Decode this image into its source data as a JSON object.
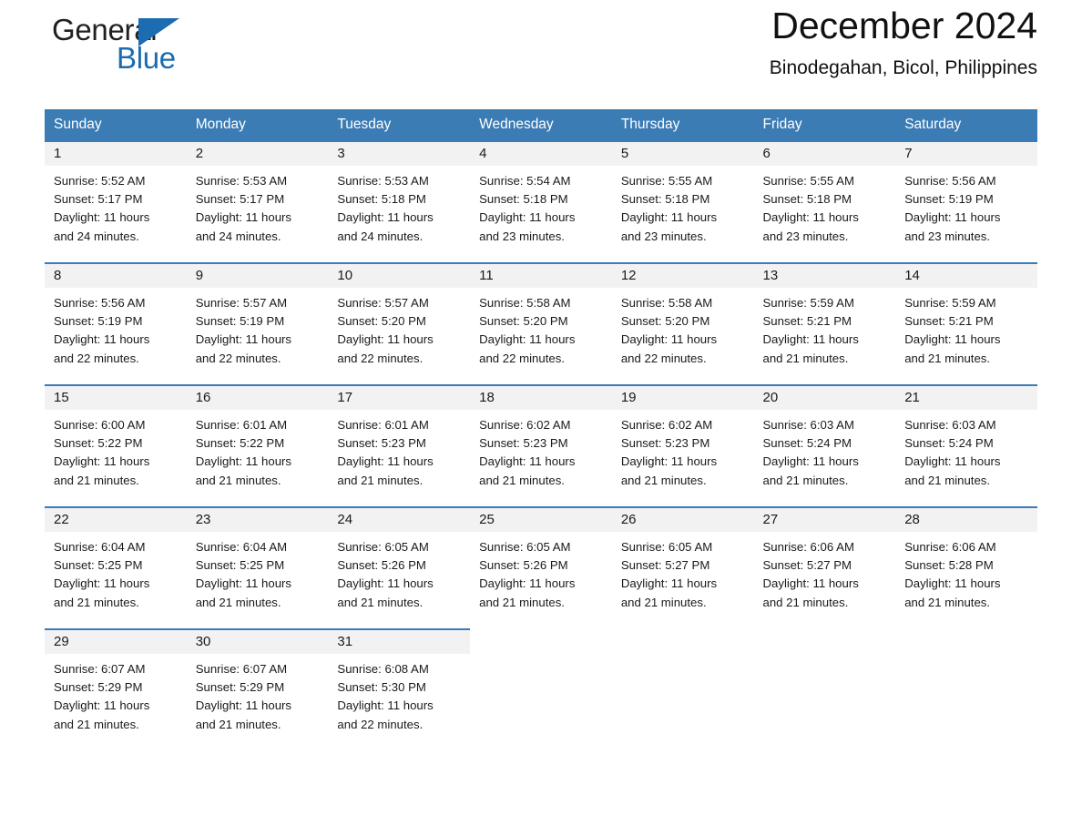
{
  "brand": {
    "name_part1": "General",
    "name_part2": "Blue",
    "accent_color": "#1b6cb0"
  },
  "header": {
    "month_title": "December 2024",
    "location": "Binodegahan, Bicol, Philippines"
  },
  "calendar": {
    "header_background": "#3b7cb5",
    "daynum_background": "#f2f2f2",
    "weekday_headers": [
      "Sunday",
      "Monday",
      "Tuesday",
      "Wednesday",
      "Thursday",
      "Friday",
      "Saturday"
    ],
    "weeks": [
      [
        {
          "day": "1",
          "sunrise": "Sunrise: 5:52 AM",
          "sunset": "Sunset: 5:17 PM",
          "daylight_line1": "Daylight: 11 hours",
          "daylight_line2": "and 24 minutes."
        },
        {
          "day": "2",
          "sunrise": "Sunrise: 5:53 AM",
          "sunset": "Sunset: 5:17 PM",
          "daylight_line1": "Daylight: 11 hours",
          "daylight_line2": "and 24 minutes."
        },
        {
          "day": "3",
          "sunrise": "Sunrise: 5:53 AM",
          "sunset": "Sunset: 5:18 PM",
          "daylight_line1": "Daylight: 11 hours",
          "daylight_line2": "and 24 minutes."
        },
        {
          "day": "4",
          "sunrise": "Sunrise: 5:54 AM",
          "sunset": "Sunset: 5:18 PM",
          "daylight_line1": "Daylight: 11 hours",
          "daylight_line2": "and 23 minutes."
        },
        {
          "day": "5",
          "sunrise": "Sunrise: 5:55 AM",
          "sunset": "Sunset: 5:18 PM",
          "daylight_line1": "Daylight: 11 hours",
          "daylight_line2": "and 23 minutes."
        },
        {
          "day": "6",
          "sunrise": "Sunrise: 5:55 AM",
          "sunset": "Sunset: 5:18 PM",
          "daylight_line1": "Daylight: 11 hours",
          "daylight_line2": "and 23 minutes."
        },
        {
          "day": "7",
          "sunrise": "Sunrise: 5:56 AM",
          "sunset": "Sunset: 5:19 PM",
          "daylight_line1": "Daylight: 11 hours",
          "daylight_line2": "and 23 minutes."
        }
      ],
      [
        {
          "day": "8",
          "sunrise": "Sunrise: 5:56 AM",
          "sunset": "Sunset: 5:19 PM",
          "daylight_line1": "Daylight: 11 hours",
          "daylight_line2": "and 22 minutes."
        },
        {
          "day": "9",
          "sunrise": "Sunrise: 5:57 AM",
          "sunset": "Sunset: 5:19 PM",
          "daylight_line1": "Daylight: 11 hours",
          "daylight_line2": "and 22 minutes."
        },
        {
          "day": "10",
          "sunrise": "Sunrise: 5:57 AM",
          "sunset": "Sunset: 5:20 PM",
          "daylight_line1": "Daylight: 11 hours",
          "daylight_line2": "and 22 minutes."
        },
        {
          "day": "11",
          "sunrise": "Sunrise: 5:58 AM",
          "sunset": "Sunset: 5:20 PM",
          "daylight_line1": "Daylight: 11 hours",
          "daylight_line2": "and 22 minutes."
        },
        {
          "day": "12",
          "sunrise": "Sunrise: 5:58 AM",
          "sunset": "Sunset: 5:20 PM",
          "daylight_line1": "Daylight: 11 hours",
          "daylight_line2": "and 22 minutes."
        },
        {
          "day": "13",
          "sunrise": "Sunrise: 5:59 AM",
          "sunset": "Sunset: 5:21 PM",
          "daylight_line1": "Daylight: 11 hours",
          "daylight_line2": "and 21 minutes."
        },
        {
          "day": "14",
          "sunrise": "Sunrise: 5:59 AM",
          "sunset": "Sunset: 5:21 PM",
          "daylight_line1": "Daylight: 11 hours",
          "daylight_line2": "and 21 minutes."
        }
      ],
      [
        {
          "day": "15",
          "sunrise": "Sunrise: 6:00 AM",
          "sunset": "Sunset: 5:22 PM",
          "daylight_line1": "Daylight: 11 hours",
          "daylight_line2": "and 21 minutes."
        },
        {
          "day": "16",
          "sunrise": "Sunrise: 6:01 AM",
          "sunset": "Sunset: 5:22 PM",
          "daylight_line1": "Daylight: 11 hours",
          "daylight_line2": "and 21 minutes."
        },
        {
          "day": "17",
          "sunrise": "Sunrise: 6:01 AM",
          "sunset": "Sunset: 5:23 PM",
          "daylight_line1": "Daylight: 11 hours",
          "daylight_line2": "and 21 minutes."
        },
        {
          "day": "18",
          "sunrise": "Sunrise: 6:02 AM",
          "sunset": "Sunset: 5:23 PM",
          "daylight_line1": "Daylight: 11 hours",
          "daylight_line2": "and 21 minutes."
        },
        {
          "day": "19",
          "sunrise": "Sunrise: 6:02 AM",
          "sunset": "Sunset: 5:23 PM",
          "daylight_line1": "Daylight: 11 hours",
          "daylight_line2": "and 21 minutes."
        },
        {
          "day": "20",
          "sunrise": "Sunrise: 6:03 AM",
          "sunset": "Sunset: 5:24 PM",
          "daylight_line1": "Daylight: 11 hours",
          "daylight_line2": "and 21 minutes."
        },
        {
          "day": "21",
          "sunrise": "Sunrise: 6:03 AM",
          "sunset": "Sunset: 5:24 PM",
          "daylight_line1": "Daylight: 11 hours",
          "daylight_line2": "and 21 minutes."
        }
      ],
      [
        {
          "day": "22",
          "sunrise": "Sunrise: 6:04 AM",
          "sunset": "Sunset: 5:25 PM",
          "daylight_line1": "Daylight: 11 hours",
          "daylight_line2": "and 21 minutes."
        },
        {
          "day": "23",
          "sunrise": "Sunrise: 6:04 AM",
          "sunset": "Sunset: 5:25 PM",
          "daylight_line1": "Daylight: 11 hours",
          "daylight_line2": "and 21 minutes."
        },
        {
          "day": "24",
          "sunrise": "Sunrise: 6:05 AM",
          "sunset": "Sunset: 5:26 PM",
          "daylight_line1": "Daylight: 11 hours",
          "daylight_line2": "and 21 minutes."
        },
        {
          "day": "25",
          "sunrise": "Sunrise: 6:05 AM",
          "sunset": "Sunset: 5:26 PM",
          "daylight_line1": "Daylight: 11 hours",
          "daylight_line2": "and 21 minutes."
        },
        {
          "day": "26",
          "sunrise": "Sunrise: 6:05 AM",
          "sunset": "Sunset: 5:27 PM",
          "daylight_line1": "Daylight: 11 hours",
          "daylight_line2": "and 21 minutes."
        },
        {
          "day": "27",
          "sunrise": "Sunrise: 6:06 AM",
          "sunset": "Sunset: 5:27 PM",
          "daylight_line1": "Daylight: 11 hours",
          "daylight_line2": "and 21 minutes."
        },
        {
          "day": "28",
          "sunrise": "Sunrise: 6:06 AM",
          "sunset": "Sunset: 5:28 PM",
          "daylight_line1": "Daylight: 11 hours",
          "daylight_line2": "and 21 minutes."
        }
      ],
      [
        {
          "day": "29",
          "sunrise": "Sunrise: 6:07 AM",
          "sunset": "Sunset: 5:29 PM",
          "daylight_line1": "Daylight: 11 hours",
          "daylight_line2": "and 21 minutes."
        },
        {
          "day": "30",
          "sunrise": "Sunrise: 6:07 AM",
          "sunset": "Sunset: 5:29 PM",
          "daylight_line1": "Daylight: 11 hours",
          "daylight_line2": "and 21 minutes."
        },
        {
          "day": "31",
          "sunrise": "Sunrise: 6:08 AM",
          "sunset": "Sunset: 5:30 PM",
          "daylight_line1": "Daylight: 11 hours",
          "daylight_line2": "and 22 minutes."
        },
        {
          "day": "",
          "sunrise": "",
          "sunset": "",
          "daylight_line1": "",
          "daylight_line2": ""
        },
        {
          "day": "",
          "sunrise": "",
          "sunset": "",
          "daylight_line1": "",
          "daylight_line2": ""
        },
        {
          "day": "",
          "sunrise": "",
          "sunset": "",
          "daylight_line1": "",
          "daylight_line2": ""
        },
        {
          "day": "",
          "sunrise": "",
          "sunset": "",
          "daylight_line1": "",
          "daylight_line2": ""
        }
      ]
    ]
  }
}
